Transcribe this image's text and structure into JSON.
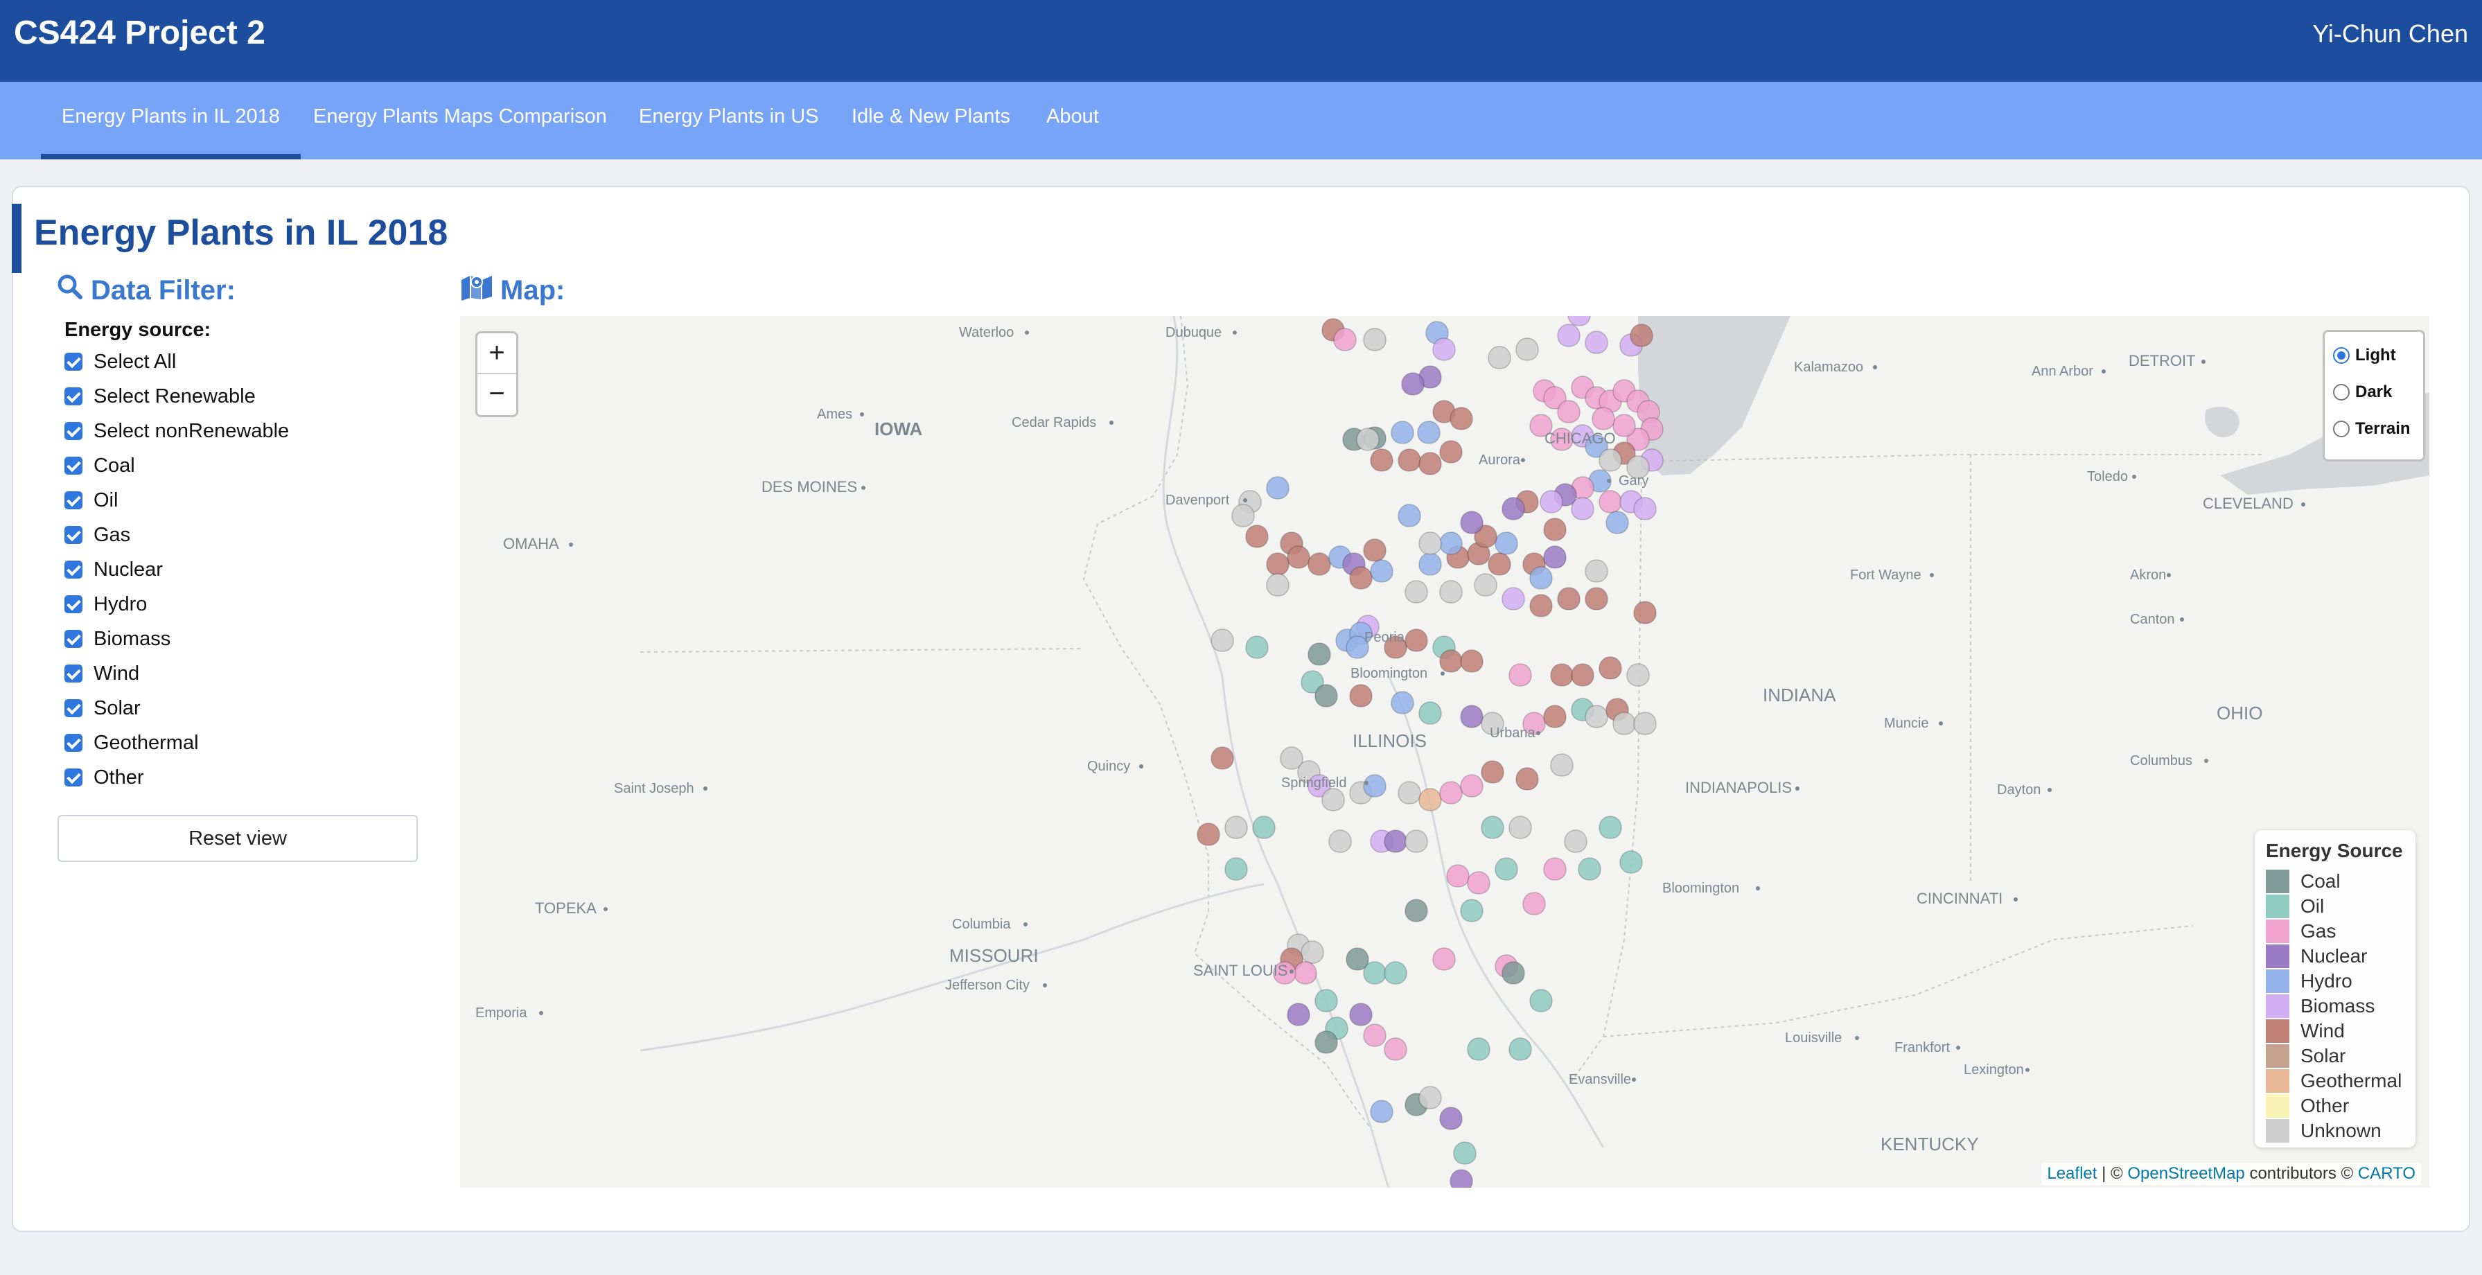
{
  "header": {
    "title": "CS424 Project 2",
    "user": "Yi-Chun Chen"
  },
  "nav": {
    "tabs": [
      {
        "label": "Energy Plants in IL 2018",
        "active": true
      },
      {
        "label": "Energy Plants Maps Comparison",
        "active": false
      },
      {
        "label": "Energy Plants in US",
        "active": false
      },
      {
        "label": "Idle & New Plants",
        "active": false
      },
      {
        "label": "About",
        "active": false
      }
    ]
  },
  "page": {
    "title": "Energy Plants in IL 2018"
  },
  "filter": {
    "heading": "Data Filter:",
    "icon": "search-icon",
    "label": "Energy source:",
    "options": [
      {
        "label": "Select All",
        "checked": true
      },
      {
        "label": "Select Renewable",
        "checked": true
      },
      {
        "label": "Select nonRenewable",
        "checked": true
      },
      {
        "label": "Coal",
        "checked": true
      },
      {
        "label": "Oil",
        "checked": true
      },
      {
        "label": "Gas",
        "checked": true
      },
      {
        "label": "Nuclear",
        "checked": true
      },
      {
        "label": "Hydro",
        "checked": true
      },
      {
        "label": "Biomass",
        "checked": true
      },
      {
        "label": "Wind",
        "checked": true
      },
      {
        "label": "Solar",
        "checked": true
      },
      {
        "label": "Geothermal",
        "checked": true
      },
      {
        "label": "Other",
        "checked": true
      }
    ],
    "reset_label": "Reset view"
  },
  "map": {
    "heading": "Map:",
    "icon": "map-icon",
    "zoom_in": "+",
    "zoom_out": "−",
    "base_layers": [
      {
        "label": "Light",
        "selected": true
      },
      {
        "label": "Dark",
        "selected": false
      },
      {
        "label": "Terrain",
        "selected": false
      }
    ],
    "legend": {
      "title": "Energy Source",
      "items": [
        {
          "label": "Coal",
          "color": "#7f9a97"
        },
        {
          "label": "Oil",
          "color": "#8fcac3"
        },
        {
          "label": "Gas",
          "color": "#f0a3cf"
        },
        {
          "label": "Nuclear",
          "color": "#9b7bc5"
        },
        {
          "label": "Hydro",
          "color": "#93b3ea"
        },
        {
          "label": "Biomass",
          "color": "#d4aef3"
        },
        {
          "label": "Wind",
          "color": "#c08078"
        },
        {
          "label": "Solar",
          "color": "#c6a18f"
        },
        {
          "label": "Geothermal",
          "color": "#e8b896"
        },
        {
          "label": "Other",
          "color": "#fbf3b5"
        },
        {
          "label": "Unknown",
          "color": "#cfcfcf"
        }
      ]
    },
    "attribution": {
      "leaflet": "Leaflet",
      "sep": " | © ",
      "osm": "OpenStreetMap",
      "mid": " contributors © ",
      "carto": "CARTO"
    },
    "places": [
      {
        "name": "Waterloo",
        "dot": true
      },
      {
        "name": "Dubuque",
        "dot": true
      },
      {
        "name": "Kalamazoo",
        "dot": true
      },
      {
        "name": "Ann Arbor",
        "dot": true
      },
      {
        "name": "DETROIT",
        "dot": true
      },
      {
        "name": "Ames",
        "dot": true
      },
      {
        "name": "IOWA",
        "dot": false
      },
      {
        "name": "Cedar Rapids",
        "dot": true
      },
      {
        "name": "CHICAGO",
        "dot": false
      },
      {
        "name": "Aurora",
        "dot": true
      },
      {
        "name": "Gary",
        "dot": true
      },
      {
        "name": "Toledo",
        "dot": true
      },
      {
        "name": "DES MOINES",
        "dot": true
      },
      {
        "name": "Davenport",
        "dot": true
      },
      {
        "name": "CLEVELAND",
        "dot": true
      },
      {
        "name": "OMAHA",
        "dot": true
      },
      {
        "name": "Fort Wayne",
        "dot": true
      },
      {
        "name": "Akron",
        "dot": true
      },
      {
        "name": "Peoria",
        "dot": true
      },
      {
        "name": "Canton",
        "dot": true
      },
      {
        "name": "Bloomington",
        "dot": true
      },
      {
        "name": "INDIANA",
        "dot": false
      },
      {
        "name": "Muncie",
        "dot": true
      },
      {
        "name": "OHIO",
        "dot": false
      },
      {
        "name": "Urbana",
        "dot": true
      },
      {
        "name": "ILLINOIS",
        "dot": false
      },
      {
        "name": "Quincy",
        "dot": true
      },
      {
        "name": "Columbus",
        "dot": true
      },
      {
        "name": "Saint Joseph",
        "dot": true
      },
      {
        "name": "Springfield",
        "dot": true
      },
      {
        "name": "INDIANAPOLIS",
        "dot": true
      },
      {
        "name": "Dayton",
        "dot": true
      },
      {
        "name": "Bloomington",
        "dot": true
      },
      {
        "name": "TOPEKA",
        "dot": true
      },
      {
        "name": "CINCINNATI",
        "dot": true
      },
      {
        "name": "Columbia",
        "dot": true
      },
      {
        "name": "MISSOURI",
        "dot": false
      },
      {
        "name": "SAINT LOUIS",
        "dot": true
      },
      {
        "name": "Jefferson City",
        "dot": true
      },
      {
        "name": "Emporia",
        "dot": true
      },
      {
        "name": "Louisville",
        "dot": true
      },
      {
        "name": "Frankfort",
        "dot": true
      },
      {
        "name": "Lexington",
        "dot": true
      },
      {
        "name": "Evansville",
        "dot": true
      },
      {
        "name": "KENTUCKY",
        "dot": false
      }
    ]
  }
}
